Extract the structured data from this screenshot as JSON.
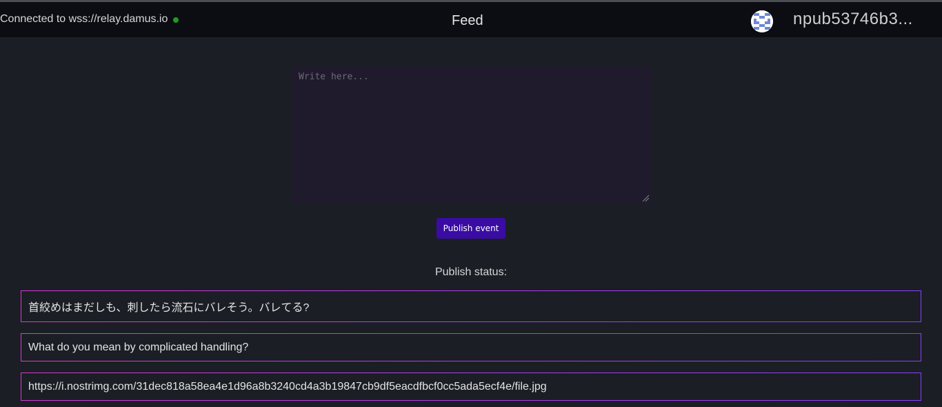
{
  "header": {
    "connection_text": "Connected to wss://relay.damus.io",
    "title": "Feed",
    "npub": "npub53746b3..."
  },
  "composer": {
    "placeholder": "Write here...",
    "value": ""
  },
  "publish_button": {
    "label": "Publish event"
  },
  "publish_status": {
    "label": "Publish status:"
  },
  "events": [
    {
      "content": "首絞めはまだしも、刺したら流石にバレそう。バレてる?"
    },
    {
      "content": "What do you mean by complicated handling?"
    },
    {
      "content": "https://i.nostrimg.com/31dec818a58ea4e1d96a8b3240cd4a3b19847cb9df5eacdfbcf0cc5ada5ecf4e/file.jpg"
    }
  ],
  "colors": {
    "background": "#1b1e24",
    "header": "#0b0d12",
    "composer": "#1f1a2c",
    "button": "#3a0ca3",
    "connected_dot": "#1f9a1f",
    "event_border_start": "#d63bd6",
    "event_border_end": "#8b3fff"
  }
}
